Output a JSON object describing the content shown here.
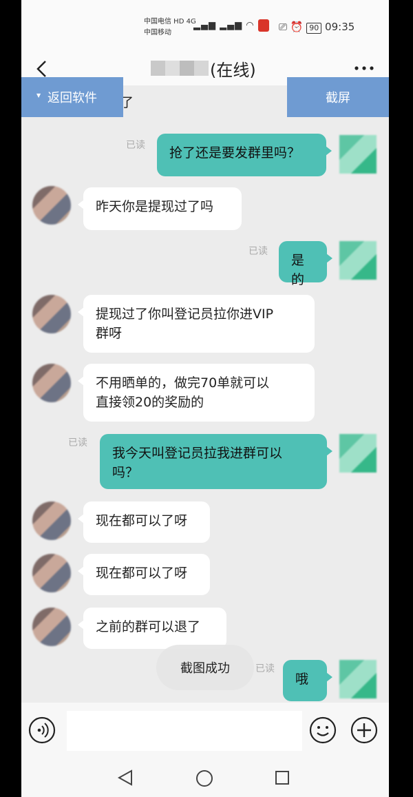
{
  "status_bar": {
    "carrier_line1": "中国电信 HD 4G",
    "carrier_line2": "中国移动",
    "battery": "90",
    "time": "09:35"
  },
  "header": {
    "contact_status": "(在线)"
  },
  "overlay": {
    "back_label": "返回软件",
    "screenshot_label": "截屏"
  },
  "messages": {
    "partial_top": "可以了",
    "m1": "抢了还是要发群里吗？",
    "m2": "昨天你是提现过了吗",
    "m3": "是的",
    "m4_line1": "提现过了你叫登记员拉你进VIP",
    "m4_line2": "群呀",
    "m5_line1": "不用晒单的，做完70单就可以",
    "m5_line2": "直接领20的奖励的",
    "m6_line1": "我今天叫登记员拉我进群可以",
    "m6_line2": "吗？",
    "m7": "现在都可以了呀",
    "m8": "现在都可以了呀",
    "m9": "之前的群可以退了",
    "m10": "哦",
    "read_label": "已读"
  },
  "toast": {
    "text": "截图成功"
  },
  "input_bar": {
    "placeholder": ""
  }
}
